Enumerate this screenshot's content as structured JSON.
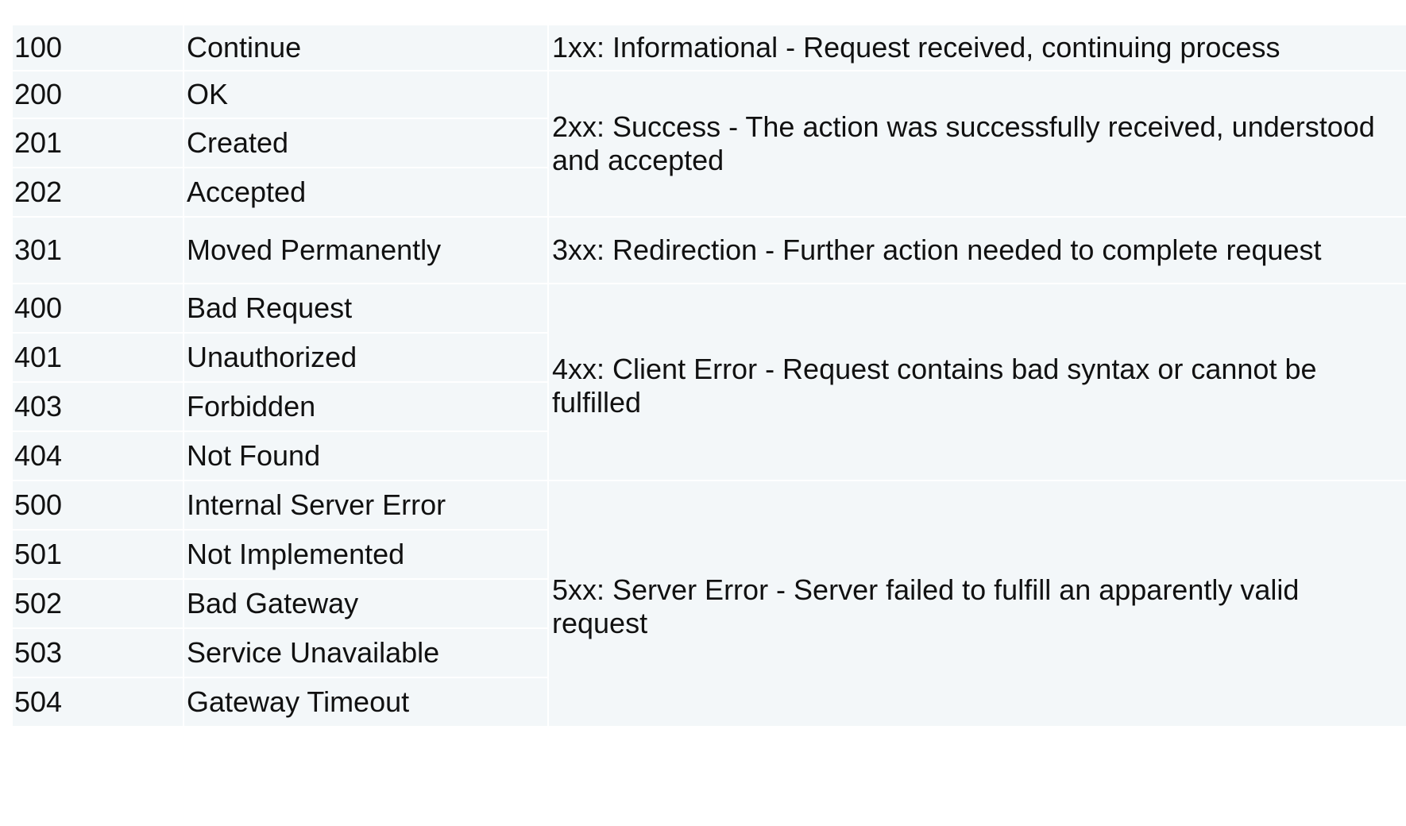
{
  "rows": [
    {
      "code": "100",
      "name": "Continue"
    },
    {
      "code": "200",
      "name": "OK"
    },
    {
      "code": "201",
      "name": "Created"
    },
    {
      "code": "202",
      "name": "Accepted"
    },
    {
      "code": "301",
      "name": "Moved Permanently"
    },
    {
      "code": "400",
      "name": "Bad Request"
    },
    {
      "code": "401",
      "name": "Unauthorized"
    },
    {
      "code": "403",
      "name": "Forbidden"
    },
    {
      "code": "404",
      "name": "Not Found"
    },
    {
      "code": "500",
      "name": "Internal Server Error"
    },
    {
      "code": "501",
      "name": "Not Implemented"
    },
    {
      "code": "502",
      "name": "Bad Gateway"
    },
    {
      "code": "503",
      "name": "Service Unavailable"
    },
    {
      "code": "504",
      "name": "Gateway Timeout"
    }
  ],
  "groups": {
    "g1xx": "1xx: Informational - Request received, continuing process",
    "g2xx": "2xx: Success - The action was successfully received, understood and accepted",
    "g3xx": "3xx: Redirection - Further action needed to complete request",
    "g4xx": "4xx: Client Error - Request contains bad syntax or cannot be fulfilled",
    "g5xx": "5xx: Server Error - Server failed to fulfill an apparently valid request"
  },
  "colors": {
    "background": "#f3f7f9",
    "gridline": "#ffffff",
    "text": "#111111"
  }
}
